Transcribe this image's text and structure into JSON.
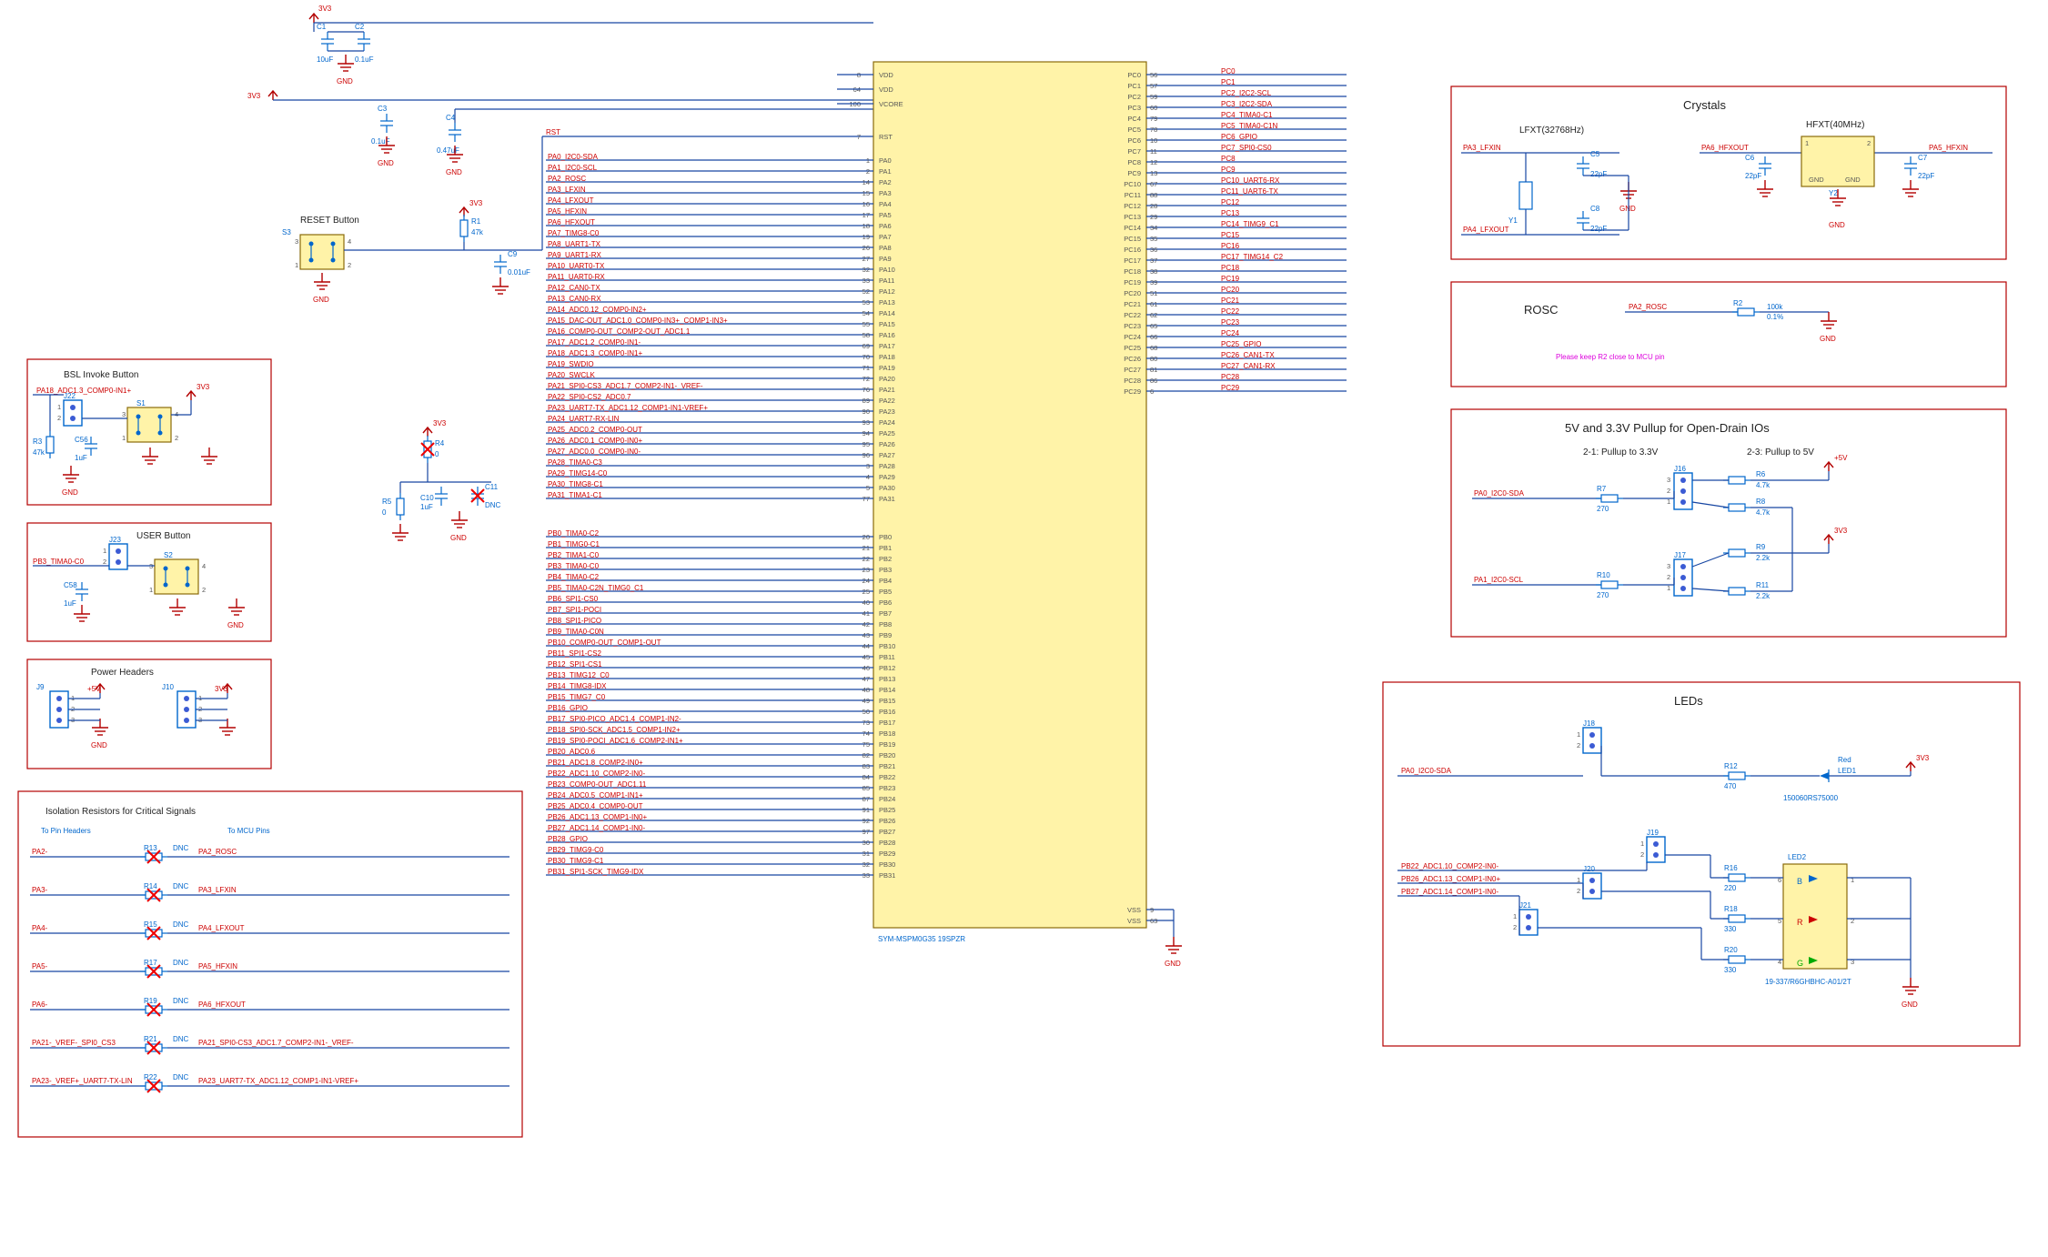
{
  "power": {
    "p3v3": "3V3",
    "p5v": "+5V",
    "gnd": "GND"
  },
  "caps": {
    "c1": {
      "ref": "C1",
      "val": "10uF"
    },
    "c2": {
      "ref": "C2",
      "val": "0.1uF"
    },
    "c3": {
      "ref": "C3",
      "val": "0.1uF"
    },
    "c4": {
      "ref": "C4",
      "val": "0.47uF"
    },
    "c5": {
      "ref": "C5",
      "val": "22pF"
    },
    "c6": {
      "ref": "C6",
      "val": "22pF"
    },
    "c7": {
      "ref": "C7",
      "val": "22pF"
    },
    "c8": {
      "ref": "C8",
      "val": "22pF"
    },
    "c9": {
      "ref": "C9",
      "val": "0.01uF"
    },
    "c10": {
      "ref": "C10",
      "val": "1uF"
    },
    "c11": {
      "ref": "C11",
      "val": "DNC"
    },
    "c56": {
      "ref": "C56",
      "val": "1uF"
    },
    "c58": {
      "ref": "C58",
      "val": "1uF"
    }
  },
  "res": {
    "r1": {
      "ref": "R1",
      "val": "47k"
    },
    "r2": {
      "ref": "R2",
      "val": "100k",
      "tol": "0.1%"
    },
    "r3": {
      "ref": "R3",
      "val": "47k"
    },
    "r4": {
      "ref": "R4",
      "val": "0"
    },
    "r5": {
      "ref": "R5",
      "val": "0"
    },
    "r6": {
      "ref": "R6",
      "val": "4.7k"
    },
    "r7": {
      "ref": "R7",
      "val": "270"
    },
    "r8": {
      "ref": "R8",
      "val": "4.7k"
    },
    "r9": {
      "ref": "R9",
      "val": "2.2k"
    },
    "r10": {
      "ref": "R10",
      "val": "270"
    },
    "r11": {
      "ref": "R11",
      "val": "2.2k"
    },
    "r12": {
      "ref": "R12",
      "val": "470"
    },
    "r16": {
      "ref": "R16",
      "val": "220"
    },
    "r18": {
      "ref": "R18",
      "val": "330"
    },
    "r20": {
      "ref": "R20",
      "val": "330"
    }
  },
  "chip": {
    "part": "SYM-MSPM0G35 19SPZR",
    "power_pins": [
      {
        "n": "8",
        "l": "VDD"
      },
      {
        "n": "64",
        "l": "VDD"
      },
      {
        "n": "100",
        "l": "VCORE"
      }
    ],
    "vss": [
      {
        "n": "9",
        "l": "VSS"
      },
      {
        "n": "63",
        "l": "VSS"
      }
    ],
    "rst_pin": "7"
  },
  "pa": [
    {
      "pin": "1",
      "n": "PA0",
      "net": "PA0_I2C0-SDA"
    },
    {
      "pin": "2",
      "n": "PA1",
      "net": "PA1_I2C0-SCL"
    },
    {
      "pin": "14",
      "n": "PA2",
      "net": "PA2_ROSC"
    },
    {
      "pin": "15",
      "n": "PA3",
      "net": "PA3_LFXIN"
    },
    {
      "pin": "16",
      "n": "PA4",
      "net": "PA4_LFXOUT"
    },
    {
      "pin": "17",
      "n": "PA5",
      "net": "PA5_HFXIN"
    },
    {
      "pin": "18",
      "n": "PA6",
      "net": "PA6_HFXOUT"
    },
    {
      "pin": "19",
      "n": "PA7",
      "net": "PA7_TIMG8-C0"
    },
    {
      "pin": "26",
      "n": "PA8",
      "net": "PA8_UART1-TX"
    },
    {
      "pin": "27",
      "n": "PA9",
      "net": "PA9_UART1-RX"
    },
    {
      "pin": "32",
      "n": "PA10",
      "net": "PA10_UART0-TX"
    },
    {
      "pin": "33",
      "n": "PA11",
      "net": "PA11_UART0-RX"
    },
    {
      "pin": "52",
      "n": "PA12",
      "net": "PA12_CAN0-TX"
    },
    {
      "pin": "53",
      "n": "PA13",
      "net": "PA13_CAN0-RX"
    },
    {
      "pin": "54",
      "n": "PA14",
      "net": "PA14_ADC0.12_COMP0-IN2+"
    },
    {
      "pin": "55",
      "n": "PA15",
      "net": "PA15_DAC-OUT_ADC1.0_COMP0-IN3+_COMP1-IN3+"
    },
    {
      "pin": "58",
      "n": "PA16",
      "net": "PA16_COMP0-OUT_COMP2-OUT_ADC1.1"
    },
    {
      "pin": "69",
      "n": "PA17",
      "net": "PA17_ADC1.2_COMP0-IN1-"
    },
    {
      "pin": "70",
      "n": "PA18",
      "net": "PA18_ADC1.3_COMP0-IN1+"
    },
    {
      "pin": "71",
      "n": "PA19",
      "net": "PA19_SWDIO"
    },
    {
      "pin": "72",
      "n": "PA20",
      "net": "PA20_SWCLK"
    },
    {
      "pin": "76",
      "n": "PA21",
      "net": "PA21_SPI0-CS3_ADC1.7_COMP2-IN1-_VREF-"
    },
    {
      "pin": "89",
      "n": "PA22",
      "net": "PA22_SPI0-CS2_ADC0.7"
    },
    {
      "pin": "90",
      "n": "PA23",
      "net": "PA23_UART7-TX_ADC1.12_COMP1-IN1-VREF+"
    },
    {
      "pin": "93",
      "n": "PA24",
      "net": "PA24_UART7-RX-LIN"
    },
    {
      "pin": "94",
      "n": "PA25",
      "net": "PA25_ADC0.2_COMP0-OUT"
    },
    {
      "pin": "95",
      "n": "PA26",
      "net": "PA26_ADC0.1_COMP0-IN0+"
    },
    {
      "pin": "96",
      "n": "PA27",
      "net": "PA27_ADC0.0_COMP0-IN0-"
    },
    {
      "pin": "3",
      "n": "PA28",
      "net": "PA28_TIMA0-C3"
    },
    {
      "pin": "4",
      "n": "PA29",
      "net": "PA29_TIMG14-C0"
    },
    {
      "pin": "5",
      "n": "PA30",
      "net": "PA30_TIMG8-C1"
    },
    {
      "pin": "77",
      "n": "PA31",
      "net": "PA31_TIMA1-C1"
    }
  ],
  "pb": [
    {
      "pin": "20",
      "n": "PB0",
      "net": "PB0_TIMA0-C2"
    },
    {
      "pin": "21",
      "n": "PB1",
      "net": "PB1_TIMG0-C1"
    },
    {
      "pin": "22",
      "n": "PB2",
      "net": "PB2_TIMA1-C0"
    },
    {
      "pin": "23",
      "n": "PB3",
      "net": "PB3_TIMA0-C0"
    },
    {
      "pin": "24",
      "n": "PB4",
      "net": "PB4_TIMA0-C2"
    },
    {
      "pin": "25",
      "n": "PB5",
      "net": "PB5_TIMA0-C2N_TIMG0_C1"
    },
    {
      "pin": "40",
      "n": "PB6",
      "net": "PB6_SPI1-CS0"
    },
    {
      "pin": "41",
      "n": "PB7",
      "net": "PB7_SPI1-POCI"
    },
    {
      "pin": "42",
      "n": "PB8",
      "net": "PB8_SPI1-PICO"
    },
    {
      "pin": "43",
      "n": "PB9",
      "net": "PB9_TIMA0-C0N"
    },
    {
      "pin": "44",
      "n": "PB10",
      "net": "PB10_COMP0-OUT_COMP1-OUT"
    },
    {
      "pin": "45",
      "n": "PB11",
      "net": "PB11_SPI1-CS2"
    },
    {
      "pin": "46",
      "n": "PB12",
      "net": "PB12_SPI1-CS1"
    },
    {
      "pin": "47",
      "n": "PB13",
      "net": "PB13_TIMG12_C0"
    },
    {
      "pin": "48",
      "n": "PB14",
      "net": "PB14_TIMG8-IDX"
    },
    {
      "pin": "49",
      "n": "PB15",
      "net": "PB15_TIMG7_C0"
    },
    {
      "pin": "50",
      "n": "PB16",
      "net": "PB16_GPIO"
    },
    {
      "pin": "73",
      "n": "PB17",
      "net": "PB17_SPI0-PICO_ADC1.4_COMP1-IN2-"
    },
    {
      "pin": "74",
      "n": "PB18",
      "net": "PB18_SPI0-SCK_ADC1.5_COMP1-IN2+"
    },
    {
      "pin": "75",
      "n": "PB19",
      "net": "PB19_SPI0-POCI_ADC1.6_COMP2-IN1+"
    },
    {
      "pin": "82",
      "n": "PB20",
      "net": "PB20_ADC0.6"
    },
    {
      "pin": "83",
      "n": "PB21",
      "net": "PB21_ADC1.8_COMP2-IN0+"
    },
    {
      "pin": "84",
      "n": "PB22",
      "net": "PB22_ADC1.10_COMP2-IN0-"
    },
    {
      "pin": "85",
      "n": "PB23",
      "net": "PB23_COMP0-OUT_ADC1.11"
    },
    {
      "pin": "87",
      "n": "PB24",
      "net": "PB24_ADC0.5_COMP1-IN1+"
    },
    {
      "pin": "91",
      "n": "PB25",
      "net": "PB25_ADC0.4_COMP0-OUT"
    },
    {
      "pin": "92",
      "n": "PB26",
      "net": "PB26_ADC1.13_COMP1-IN0+"
    },
    {
      "pin": "97",
      "n": "PB27",
      "net": "PB27_ADC1.14_COMP1-IN0-"
    },
    {
      "pin": "30",
      "n": "PB28",
      "net": "PB28_GPIO"
    },
    {
      "pin": "31",
      "n": "PB29",
      "net": "PB29_TIMG9-C0"
    },
    {
      "pin": "32",
      "n": "PB30",
      "net": "PB30_TIMG9-C1"
    },
    {
      "pin": "33",
      "n": "PB31",
      "net": "PB31_SPI1-SCK_TIMG9-IDX"
    }
  ],
  "pc": [
    {
      "pin": "56",
      "n": "PC0",
      "net": "PC0"
    },
    {
      "pin": "57",
      "n": "PC1",
      "net": "PC1"
    },
    {
      "pin": "59",
      "n": "PC2",
      "net": "PC2_I2C2-SCL"
    },
    {
      "pin": "60",
      "n": "PC3",
      "net": "PC3_I2C2-SDA"
    },
    {
      "pin": "79",
      "n": "PC4",
      "net": "PC4_TIMA0-C1"
    },
    {
      "pin": "78",
      "n": "PC5",
      "net": "PC5_TIMA0-C1N"
    },
    {
      "pin": "10",
      "n": "PC6",
      "net": "PC6_GPIO"
    },
    {
      "pin": "11",
      "n": "PC7",
      "net": "PC7_SPI0-CS0"
    },
    {
      "pin": "12",
      "n": "PC8",
      "net": "PC8"
    },
    {
      "pin": "13",
      "n": "PC9",
      "net": "PC9"
    },
    {
      "pin": "67",
      "n": "PC10",
      "net": "PC10_UART6-RX"
    },
    {
      "pin": "88",
      "n": "PC11",
      "net": "PC11_UART6-TX"
    },
    {
      "pin": "28",
      "n": "PC12",
      "net": "PC12"
    },
    {
      "pin": "29",
      "n": "PC13",
      "net": "PC13"
    },
    {
      "pin": "34",
      "n": "PC14",
      "net": "PC14_TIMG9_C1"
    },
    {
      "pin": "35",
      "n": "PC15",
      "net": "PC15"
    },
    {
      "pin": "36",
      "n": "PC16",
      "net": "PC16"
    },
    {
      "pin": "37",
      "n": "PC17",
      "net": "PC17_TIMG14_C2"
    },
    {
      "pin": "38",
      "n": "PC18",
      "net": "PC18"
    },
    {
      "pin": "39",
      "n": "PC19",
      "net": "PC19"
    },
    {
      "pin": "51",
      "n": "PC20",
      "net": "PC20"
    },
    {
      "pin": "61",
      "n": "PC21",
      "net": "PC21"
    },
    {
      "pin": "62",
      "n": "PC22",
      "net": "PC22"
    },
    {
      "pin": "65",
      "n": "PC23",
      "net": "PC23"
    },
    {
      "pin": "66",
      "n": "PC24",
      "net": "PC24"
    },
    {
      "pin": "68",
      "n": "PC25",
      "net": "PC25_GPIO"
    },
    {
      "pin": "80",
      "n": "PC26",
      "net": "PC26_CAN1-TX"
    },
    {
      "pin": "81",
      "n": "PC27",
      "net": "PC27_CAN1-RX"
    },
    {
      "pin": "86",
      "n": "PC28",
      "net": "PC28"
    },
    {
      "pin": "6",
      "n": "PC29",
      "net": "PC29"
    }
  ],
  "left": {
    "reset": {
      "title": "RESET Button",
      "sw": "S3",
      "net": "RST"
    },
    "bsl": {
      "title": "BSL Invoke Button",
      "hdr": "J22",
      "sw": "S1",
      "net": "PA18_ADC1.3_COMP0-IN1+"
    },
    "user": {
      "title": "USER Button",
      "hdr": "J23",
      "sw": "S2",
      "net": "PB3_TIMA0-C0"
    },
    "pwrhdr": {
      "title": "Power Headers",
      "j9": "J9",
      "j10": "J10"
    },
    "iso": {
      "title": "Isolation Resistors for Critical Signals",
      "h1": "To Pin Headers",
      "h2": "To MCU Pins",
      "rows": [
        {
          "l": "PA2-",
          "r": "R13",
          "d": "DNC",
          "rt": "PA2_ROSC"
        },
        {
          "l": "PA3-",
          "r": "R14",
          "d": "DNC",
          "rt": "PA3_LFXIN"
        },
        {
          "l": "PA4-",
          "r": "R15",
          "d": "DNC",
          "rt": "PA4_LFXOUT"
        },
        {
          "l": "PA5-",
          "r": "R17",
          "d": "DNC",
          "rt": "PA5_HFXIN"
        },
        {
          "l": "PA6-",
          "r": "R19",
          "d": "DNC",
          "rt": "PA6_HFXOUT"
        },
        {
          "l": "PA21-_VREF-_SPI0_CS3",
          "r": "R21",
          "d": "DNC",
          "rt": "PA21_SPI0-CS3_ADC1.7_COMP2-IN1-_VREF-"
        },
        {
          "l": "PA23-_VREF+_UART7-TX-LIN",
          "r": "R22",
          "d": "DNC",
          "rt": "PA23_UART7-TX_ADC1.12_COMP1-IN1-VREF+"
        }
      ]
    }
  },
  "right": {
    "xtal": {
      "title": "Crystals",
      "lfxt": "LFXT(32768Hz)",
      "hfxt": "HFXT(40MHz)",
      "y1": "Y1",
      "y2": "Y2",
      "ina": "PA3_LFXIN",
      "outa": "PA4_LFXOUT",
      "inb": "PA5_HFXIN",
      "outb": "PA6_HFXOUT"
    },
    "rosc": {
      "title": "ROSC",
      "net": "PA2_ROSC",
      "note": "Please keep R2 close to MCU pin"
    },
    "pull": {
      "title": "5V and 3.3V Pullup for Open-Drain IOs",
      "s1": "2-1: Pullup to 3.3V",
      "s2": "2-3: Pullup to 5V",
      "j16": "J16",
      "j17": "J17",
      "sda": "PA0_I2C0-SDA",
      "scl": "PA1_I2C0-SCL"
    },
    "leds": {
      "title": "LEDs",
      "j18": "J18",
      "j19": "J19",
      "j20": "J20",
      "j21": "J21",
      "led1": {
        "ref": "LED1",
        "col": "Red",
        "pn": "150060RS75000"
      },
      "led2": {
        "ref": "LED2",
        "pn": "19-337/R6GHBHC-A01/2T",
        "b": "B",
        "r": "R",
        "g": "G"
      },
      "n0": "PA0_I2C0-SDA",
      "n1": "PB22_ADC1.10_COMP2-IN0-",
      "n2": "PB26_ADC1.13_COMP1-IN0+",
      "n3": "PB27_ADC1.14_COMP1-IN0-"
    }
  }
}
